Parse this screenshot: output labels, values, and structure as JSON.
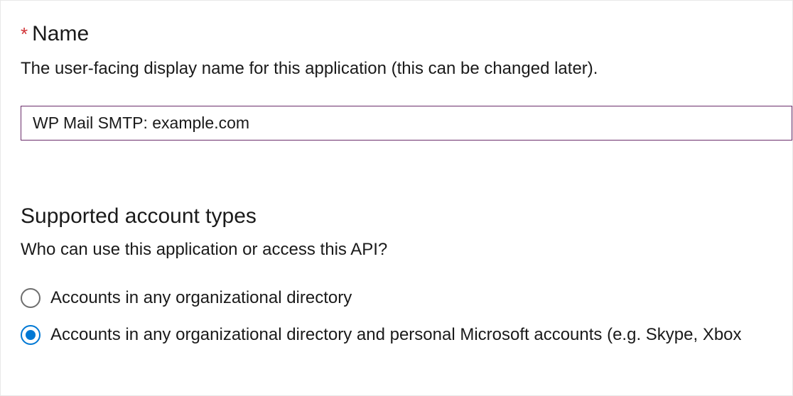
{
  "nameField": {
    "requiredMark": "*",
    "label": "Name",
    "description": "The user-facing display name for this application (this can be changed later).",
    "value": "WP Mail SMTP: example.com"
  },
  "accountTypes": {
    "heading": "Supported account types",
    "description": "Who can use this application or access this API?",
    "options": [
      {
        "label": "Accounts in any organizational directory",
        "selected": false
      },
      {
        "label": "Accounts in any organizational directory and personal Microsoft accounts (e.g. Skype, Xbox",
        "selected": true
      }
    ]
  }
}
